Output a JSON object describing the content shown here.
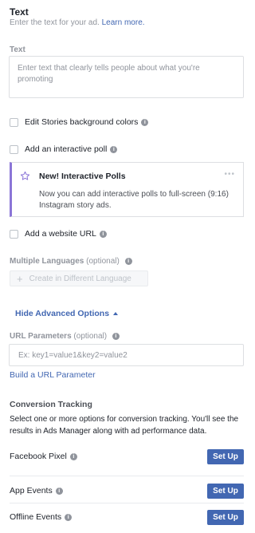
{
  "header": {
    "title": "Text",
    "subtitle": "Enter the text for your ad.",
    "learn_more": "Learn more."
  },
  "text_field": {
    "label": "Text",
    "placeholder": "Enter text that clearly tells people about what you're promoting"
  },
  "options": {
    "stories_bg": "Edit Stories background colors",
    "interactive_poll": "Add an interactive poll",
    "website_url": "Add a website URL"
  },
  "callout": {
    "title": "New! Interactive Polls",
    "body": "Now you can add interactive polls to full-screen (9:16) Instagram story ads.",
    "more": "•••"
  },
  "languages": {
    "label": "Multiple Languages",
    "optional": "(optional)",
    "button": "Create in Different Language"
  },
  "advanced": {
    "toggle": "Hide Advanced Options"
  },
  "url_params": {
    "label": "URL Parameters",
    "optional": "(optional)",
    "placeholder": "Ex: key1=value1&key2=value2",
    "build_link": "Build a URL Parameter"
  },
  "conversion": {
    "title": "Conversion Tracking",
    "description": "Select one or more options for conversion tracking. You'll see the results in Ads Manager along with ad performance data.",
    "rows": [
      {
        "label": "Facebook Pixel",
        "button": "Set Up"
      },
      {
        "label": "App Events",
        "button": "Set Up"
      },
      {
        "label": "Offline Events",
        "button": "Set Up"
      }
    ]
  },
  "info_glyph": "i",
  "colors": {
    "accent": "#4267b2",
    "callout_border": "#8b75d7"
  }
}
